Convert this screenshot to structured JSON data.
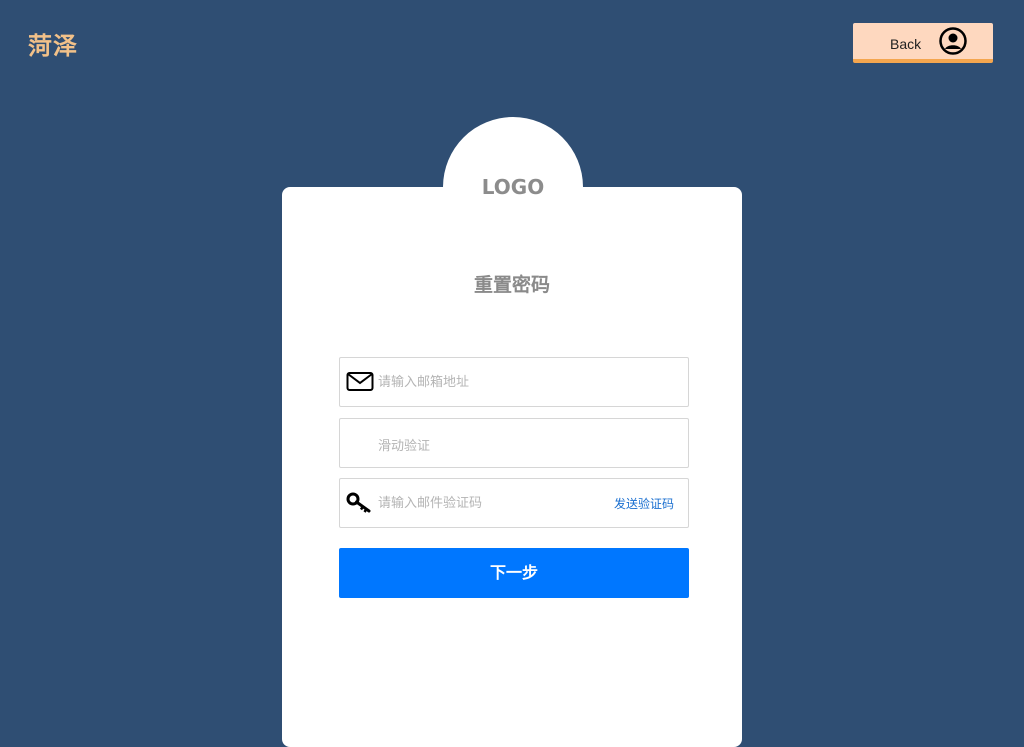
{
  "header": {
    "brand": "菏泽",
    "back_label": "Back",
    "back_icon": "user-circle-icon"
  },
  "card": {
    "logo": "LOGO",
    "title": "重置密码",
    "email": {
      "placeholder": "请输入邮箱地址",
      "value": "",
      "icon": "envelope-icon"
    },
    "slider": {
      "label": "滑动验证"
    },
    "code": {
      "placeholder": "请输入邮件验证码",
      "value": "",
      "icon": "key-icon",
      "send_label": "发送验证码"
    },
    "next_label": "下一步"
  },
  "colors": {
    "background": "#2f4e73",
    "brand": "#f2c189",
    "back_button": "#fed8bf",
    "back_button_border": "#f4a64f",
    "primary": "#0077ff",
    "link": "#1a6fd0"
  }
}
